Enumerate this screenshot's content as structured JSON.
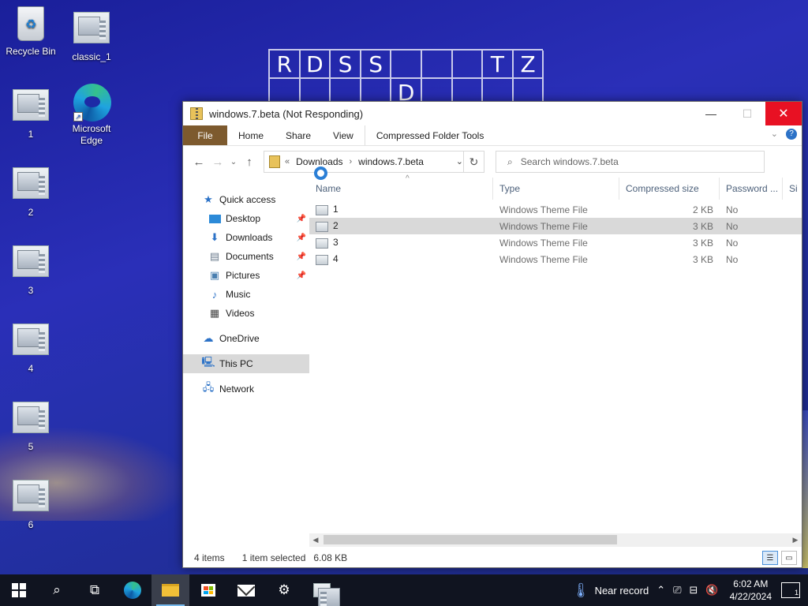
{
  "desktop": {
    "wallpaper_letters": [
      "R",
      "D",
      "S",
      "S",
      "",
      "",
      "",
      "T",
      "Z",
      "",
      "",
      "",
      "",
      "D",
      "",
      "",
      "",
      ""
    ],
    "icons": [
      {
        "label": "Recycle Bin",
        "kind": "bin"
      },
      {
        "label": "classic_1",
        "kind": "theme"
      },
      {
        "label": "1",
        "kind": "theme"
      },
      {
        "label": "Microsoft Edge",
        "kind": "edge"
      },
      {
        "label": "2",
        "kind": "theme"
      },
      {
        "label": "3",
        "kind": "theme"
      },
      {
        "label": "4",
        "kind": "theme"
      },
      {
        "label": "5",
        "kind": "theme"
      },
      {
        "label": "6",
        "kind": "theme"
      }
    ]
  },
  "window": {
    "title": "windows.7.beta (Not Responding)",
    "controls": {
      "minimize": "—",
      "maximize": "☐",
      "close": "✕"
    },
    "ribbon": {
      "tabs": [
        "File",
        "Home",
        "Share",
        "View",
        "Compressed Folder Tools"
      ],
      "expand_glyph": "⌄",
      "help_glyph": "?"
    },
    "nav": {
      "back": "←",
      "forward": "→",
      "recent": "⌄",
      "up": "↑",
      "address": {
        "overflow": "«",
        "segments": [
          "Downloads",
          "windows.7.beta"
        ],
        "separator": "›",
        "dropdown": "⌄",
        "refresh": "↻"
      },
      "search_placeholder": "Search windows.7.beta"
    },
    "navpane": {
      "quick_access": "Quick access",
      "pinned": [
        {
          "label": "Desktop",
          "icon": "desktop-icon",
          "pinned": true
        },
        {
          "label": "Downloads",
          "icon": "downloads-icon",
          "pinned": true
        },
        {
          "label": "Documents",
          "icon": "documents-icon",
          "pinned": true
        },
        {
          "label": "Pictures",
          "icon": "pictures-icon",
          "pinned": true
        },
        {
          "label": "Music",
          "icon": "music-icon",
          "pinned": false
        },
        {
          "label": "Videos",
          "icon": "videos-icon",
          "pinned": false
        }
      ],
      "onedrive": "OneDrive",
      "this_pc": "This PC",
      "network": "Network"
    },
    "columns": [
      "Name",
      "Type",
      "Compressed size",
      "Password ...",
      "Si"
    ],
    "files": [
      {
        "name": "1",
        "type": "Windows Theme File",
        "size": "2 KB",
        "password": "No",
        "selected": false
      },
      {
        "name": "2",
        "type": "Windows Theme File",
        "size": "3 KB",
        "password": "No",
        "selected": true
      },
      {
        "name": "3",
        "type": "Windows Theme File",
        "size": "3 KB",
        "password": "No",
        "selected": false
      },
      {
        "name": "4",
        "type": "Windows Theme File",
        "size": "3 KB",
        "password": "No",
        "selected": false
      }
    ],
    "status": {
      "items": "4 items",
      "selected": "1 item selected",
      "size": "6.08 KB"
    }
  },
  "taskbar": {
    "weather": "Near record",
    "time": "6:02 AM",
    "date": "4/22/2024",
    "notifications": "1",
    "accent": "#76b9ed"
  },
  "colors": {
    "close_button": "#e81123",
    "file_tab": "#7d5a2e",
    "selection": "#d9d9d9"
  }
}
